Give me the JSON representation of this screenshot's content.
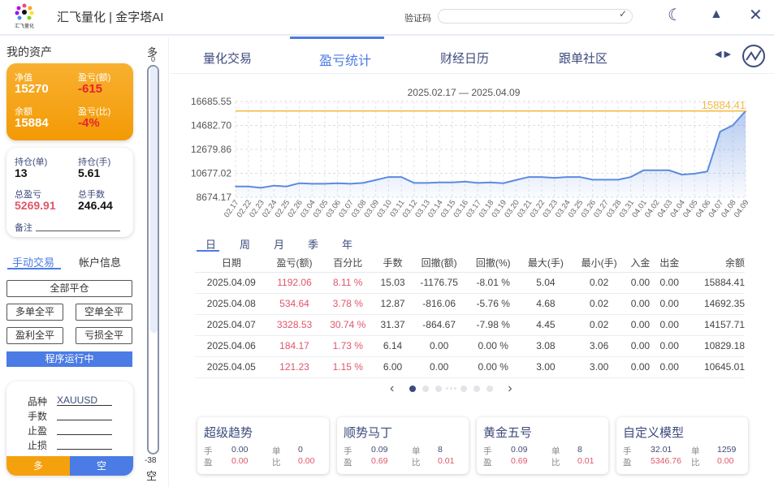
{
  "header": {
    "title": "汇飞量化 | 金字塔AI",
    "logo_text": "汇飞量化",
    "captcha_label": "验证码",
    "captcha_value": ""
  },
  "sidebar": {
    "title": "我的资产",
    "summary": {
      "net_label": "净值",
      "net": "15270",
      "pnl_label": "盈亏(额)",
      "pnl": "-615",
      "balance_label": "余额",
      "balance": "15884",
      "pnl_pct_label": "盈亏(比)",
      "pnl_pct": "-4%"
    },
    "positions": {
      "orders_label": "持仓(单)",
      "orders": "13",
      "lots_label": "持仓(手)",
      "lots": "5.61",
      "total_pnl_label": "总盈亏",
      "total_pnl": "5269.91",
      "total_lots_label": "总手数",
      "total_lots": "246.44",
      "note_label": "备注"
    },
    "tabs": [
      "手动交易",
      "帐户信息"
    ],
    "buttons": {
      "close_all": "全部平仓",
      "close_long": "多单全平",
      "close_short": "空单全平",
      "close_profit": "盈利全平",
      "close_loss": "亏损全平"
    },
    "status": "程序运行中",
    "order": {
      "symbol_label": "品种",
      "symbol": "XAUUSD",
      "lots_label": "手数",
      "tp_label": "止盈",
      "sl_label": "止损",
      "long": "多",
      "short": "空"
    },
    "slider": {
      "top_label": "多",
      "top_value": "0",
      "bottom_value": "-38",
      "bottom_label": "空",
      "fill_fraction": 0.69
    }
  },
  "main_tabs": [
    "量化交易",
    "盈亏统计",
    "财经日历",
    "跟单社区"
  ],
  "active_tab": 1,
  "chart_data": {
    "type": "line",
    "title": "2025.02.17 — 2025.04.09",
    "yticks": [
      "16685.55",
      "14682.70",
      "12679.86",
      "10677.02",
      "8674.17"
    ],
    "ylim": [
      8674.17,
      16685.55
    ],
    "reference_line": {
      "value": 15884.41,
      "label": "15884.41",
      "color": "#f5b942"
    },
    "line_color": "#5b8be0",
    "x": [
      "02.17",
      "02.22",
      "02.23",
      "02.24",
      "02.25",
      "02.26",
      "03.04",
      "03.05",
      "03.06",
      "03.07",
      "03.08",
      "03.09",
      "03.10",
      "03.11",
      "03.12",
      "03.13",
      "03.14",
      "03.15",
      "03.16",
      "03.17",
      "03.18",
      "03.19",
      "03.20",
      "03.21",
      "03.22",
      "03.23",
      "03.24",
      "03.25",
      "03.26",
      "03.27",
      "03.28",
      "03.31",
      "04.01",
      "04.02",
      "04.03",
      "04.04",
      "04.05",
      "04.06",
      "04.07",
      "04.08",
      "04.09"
    ],
    "y": [
      9577,
      9577,
      9464,
      9645,
      9577,
      9848,
      9803,
      9803,
      9848,
      9803,
      9870,
      10118,
      10367,
      10367,
      9870,
      9870,
      9915,
      9915,
      9983,
      9870,
      9915,
      9848,
      10118,
      10367,
      10367,
      10299,
      10367,
      10367,
      10141,
      10141,
      10141,
      10367,
      10931,
      10931,
      10931,
      10570,
      10645.01,
      10829.18,
      14157.71,
      14692.35,
      15884.41
    ]
  },
  "periods": [
    "日",
    "周",
    "月",
    "季",
    "年"
  ],
  "table": {
    "headers": [
      "日期",
      "盈亏(额)",
      "百分比",
      "手数",
      "回撤(额)",
      "回撤(%)",
      "最大(手)",
      "最小(手)",
      "入金",
      "出金",
      "余额"
    ],
    "rows": [
      [
        "2025.04.09",
        "1192.06",
        "8.11 %",
        "15.03",
        "-1176.75",
        "-8.01 %",
        "5.04",
        "0.02",
        "0.00",
        "0.00",
        "15884.41"
      ],
      [
        "2025.04.08",
        "534.64",
        "3.78 %",
        "12.87",
        "-816.06",
        "-5.76 %",
        "4.68",
        "0.02",
        "0.00",
        "0.00",
        "14692.35"
      ],
      [
        "2025.04.07",
        "3328.53",
        "30.74 %",
        "31.37",
        "-864.67",
        "-7.98 %",
        "4.45",
        "0.02",
        "0.00",
        "0.00",
        "14157.71"
      ],
      [
        "2025.04.06",
        "184.17",
        "1.73 %",
        "6.14",
        "0.00",
        "0.00 %",
        "3.08",
        "3.06",
        "0.00",
        "0.00",
        "10829.18"
      ],
      [
        "2025.04.05",
        "121.23",
        "1.15 %",
        "6.00",
        "0.00",
        "0.00 %",
        "3.00",
        "3.00",
        "0.00",
        "0.00",
        "10645.01"
      ]
    ]
  },
  "strategies": [
    {
      "name": "超级趋势",
      "lots": "0.00",
      "orders": "0",
      "profit": "0.00",
      "ratio": "0.00"
    },
    {
      "name": "顺势马丁",
      "lots": "0.09",
      "orders": "8",
      "profit": "0.69",
      "ratio": "0.01"
    },
    {
      "name": "黄金五号",
      "lots": "0.09",
      "orders": "8",
      "profit": "0.69",
      "ratio": "0.01"
    },
    {
      "name": "自定义模型",
      "lots": "32.01",
      "orders": "1259",
      "profit": "5346.76",
      "ratio": "0.00"
    }
  ],
  "strategy_labels": {
    "lots": "手",
    "orders": "单",
    "profit": "盈",
    "ratio": "比"
  }
}
